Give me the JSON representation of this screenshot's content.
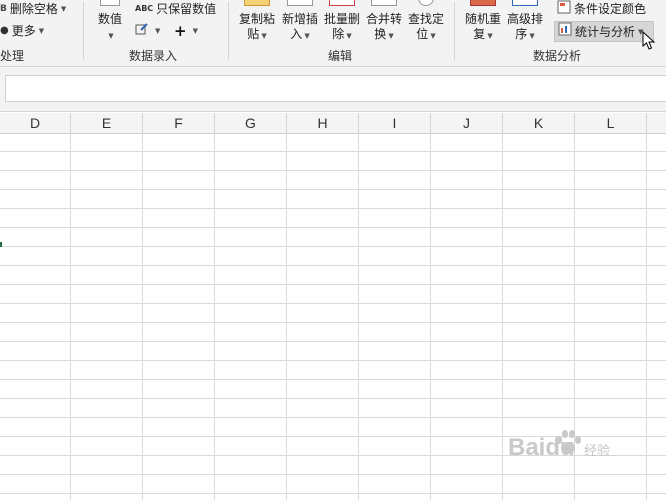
{
  "ribbon": {
    "processing": {
      "delete_spaces": "删除空格",
      "more": "更多",
      "group_label": "处理"
    },
    "data_entry": {
      "numeric": "数值",
      "keep_numeric": "只保留数值",
      "group_label": "数据录入"
    },
    "edit": {
      "copy_paste": [
        "复制粘",
        "贴"
      ],
      "insert": [
        "新增插",
        "入"
      ],
      "batch_delete": [
        "批量删",
        "除"
      ],
      "merge": [
        "合并转",
        "换"
      ],
      "find": [
        "查找定",
        "位"
      ],
      "group_label": "编辑"
    },
    "analysis": {
      "random": [
        "随机重",
        "复"
      ],
      "sort": [
        "高级排",
        "序"
      ],
      "cond_color": "条件设定颜色",
      "stats": "统计与分析",
      "group_label": "数据分析"
    }
  },
  "columns": [
    "D",
    "E",
    "F",
    "G",
    "H",
    "I",
    "J",
    "K",
    "L"
  ],
  "watermark": {
    "text": "Baidu",
    "sub": "经验"
  }
}
